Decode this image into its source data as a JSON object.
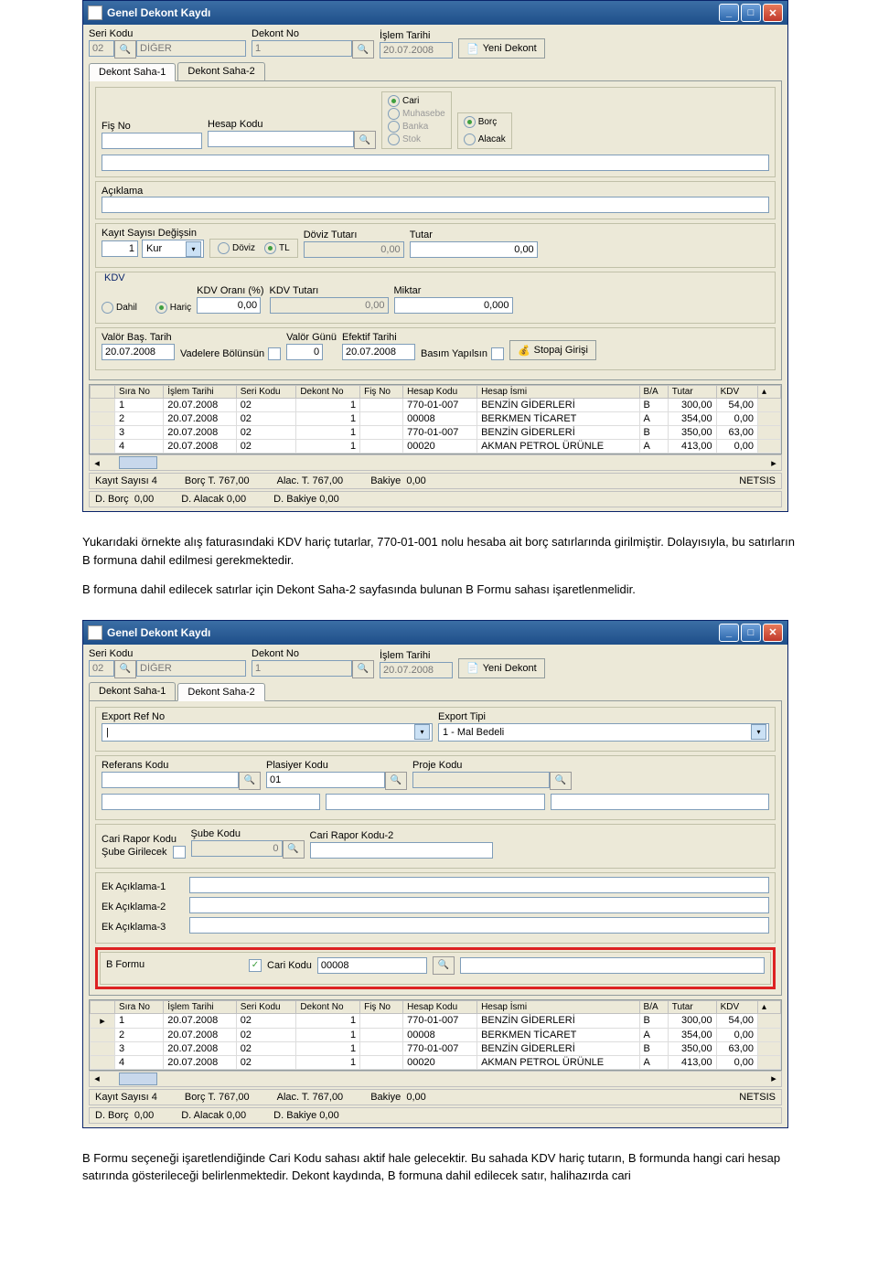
{
  "window_title": "Genel Dekont Kaydı",
  "header": {
    "seri_kodu_lbl": "Seri Kodu",
    "seri_kodu_val": "02",
    "seri_kodu_desc": "DİĞER",
    "dekont_no_lbl": "Dekont No",
    "dekont_no_val": "1",
    "islem_tarihi_lbl": "İşlem Tarihi",
    "islem_tarihi_val": "20.07.2008",
    "yeni_dekont_btn": "Yeni Dekont"
  },
  "tabs": {
    "saha1": "Dekont Saha-1",
    "saha2": "Dekont Saha-2"
  },
  "saha1": {
    "fis_no_lbl": "Fiş No",
    "hesap_kodu_lbl": "Hesap Kodu",
    "type_radios": {
      "cari": "Cari",
      "muhasebe": "Muhasebe",
      "banka": "Banka",
      "stok": "Stok"
    },
    "ba_radios": {
      "borc": "Borç",
      "alacak": "Alacak"
    },
    "aciklama_lbl": "Açıklama",
    "kayit_sayisi_lbl": "Kayıt Sayısı",
    "degissin_lbl": "Değişsin",
    "kayit_sayisi_val": "1",
    "kur_lbl": "Kur",
    "doviz_radio": "Döviz",
    "tl_radio": "TL",
    "doviz_tutari_lbl": "Döviz Tutarı",
    "doviz_tutari_val": "0,00",
    "tutar_lbl": "Tutar",
    "tutar_val": "0,00",
    "kdv_lbl": "KDV",
    "dahil": "Dahil",
    "haric": "Hariç",
    "kdv_orani_lbl": "KDV Oranı (%)",
    "kdv_orani_val": "0,00",
    "kdv_tutari_lbl": "KDV Tutarı",
    "kdv_tutari_val": "0,00",
    "miktar_lbl": "Miktar",
    "miktar_val": "0,000",
    "valor_bas_lbl": "Valör Baş. Tarih",
    "valor_bas_val": "20.07.2008",
    "vadelere_bolunsun": "Vadelere Bölünsün",
    "valor_gunu_lbl": "Valör Günü",
    "valor_gunu_val": "0",
    "efektif_tarihi_lbl": "Efektif Tarihi",
    "efektif_tarihi_val": "20.07.2008",
    "basim_yapilsin": "Basım Yapılsın",
    "stopaj_btn": "Stopaj Girişi"
  },
  "saha2": {
    "export_ref_lbl": "Export Ref No",
    "export_tipi_lbl": "Export Tipi",
    "export_tipi_val": "1 - Mal Bedeli",
    "referans_lbl": "Referans Kodu",
    "plasiyer_lbl": "Plasiyer Kodu",
    "plasiyer_val": "01",
    "proje_lbl": "Proje Kodu",
    "cari_rapor_lbl": "Cari Rapor Kodu",
    "sube_girilecek": "Şube Girilecek",
    "sube_kodu_lbl": "Şube Kodu",
    "sube_kodu_val": "0",
    "cari_rapor2_lbl": "Cari Rapor Kodu-2",
    "ek1_lbl": "Ek Açıklama-1",
    "ek2_lbl": "Ek Açıklama-2",
    "ek3_lbl": "Ek Açıklama-3",
    "bformu_lbl": "B Formu",
    "cari_kodu_lbl": "Cari Kodu",
    "cari_kodu_val": "00008"
  },
  "table": {
    "cols": {
      "sira": "Sıra No",
      "tarih": "İşlem Tarihi",
      "seri": "Seri Kodu",
      "dekont": "Dekont No",
      "fis": "Fiş No",
      "hesap": "Hesap Kodu",
      "isim": "Hesap İsmi",
      "ba": "B/A",
      "tutar": "Tutar",
      "kdv": "KDV"
    },
    "rows": [
      {
        "sira": "1",
        "tarih": "20.07.2008",
        "seri": "02",
        "dekont": "1",
        "fis": "",
        "hesap": "770-01-007",
        "isim": "BENZİN GİDERLERİ",
        "ba": "B",
        "tutar": "300,00",
        "kdv": "54,00"
      },
      {
        "sira": "2",
        "tarih": "20.07.2008",
        "seri": "02",
        "dekont": "1",
        "fis": "",
        "hesap": "00008",
        "isim": "BERKMEN TİCARET",
        "ba": "A",
        "tutar": "354,00",
        "kdv": "0,00"
      },
      {
        "sira": "3",
        "tarih": "20.07.2008",
        "seri": "02",
        "dekont": "1",
        "fis": "",
        "hesap": "770-01-007",
        "isim": "BENZİN GİDERLERİ",
        "ba": "B",
        "tutar": "350,00",
        "kdv": "63,00"
      },
      {
        "sira": "4",
        "tarih": "20.07.2008",
        "seri": "02",
        "dekont": "1",
        "fis": "",
        "hesap": "00020",
        "isim": "AKMAN PETROL ÜRÜNLE",
        "ba": "A",
        "tutar": "413,00",
        "kdv": "0,00"
      }
    ]
  },
  "status1": {
    "kayit": "Kayıt Sayısı  4",
    "borc": "Borç T.  767,00",
    "alac": "Alac. T.  767,00",
    "bakiye": "Bakiye",
    "bakiye_val": "0,00",
    "netsis": "NETSIS"
  },
  "status2": {
    "dborc": "D. Borç",
    "dborc_v": "0,00",
    "dalac": "D. Alacak 0,00",
    "dbak": "D. Bakiye 0,00"
  },
  "doc": {
    "p1": "Yukarıdaki örnekte alış faturasındaki KDV hariç tutarlar, 770-01-001 nolu hesaba ait borç satırlarında girilmiştir. Dolayısıyla, bu satırların B formuna dahil edilmesi gerekmektedir.",
    "p2": "B formuna dahil edilecek satırlar için Dekont Saha-2 sayfasında bulunan B Formu sahası işaretlenmelidir.",
    "p3": "B Formu seçeneği işaretlendiğinde Cari Kodu sahası aktif hale gelecektir. Bu sahada KDV hariç tutarın, B formunda hangi cari hesap satırında gösterileceği belirlenmektedir. Dekont kaydında, B formuna dahil edilecek satır, halihazırda cari"
  }
}
